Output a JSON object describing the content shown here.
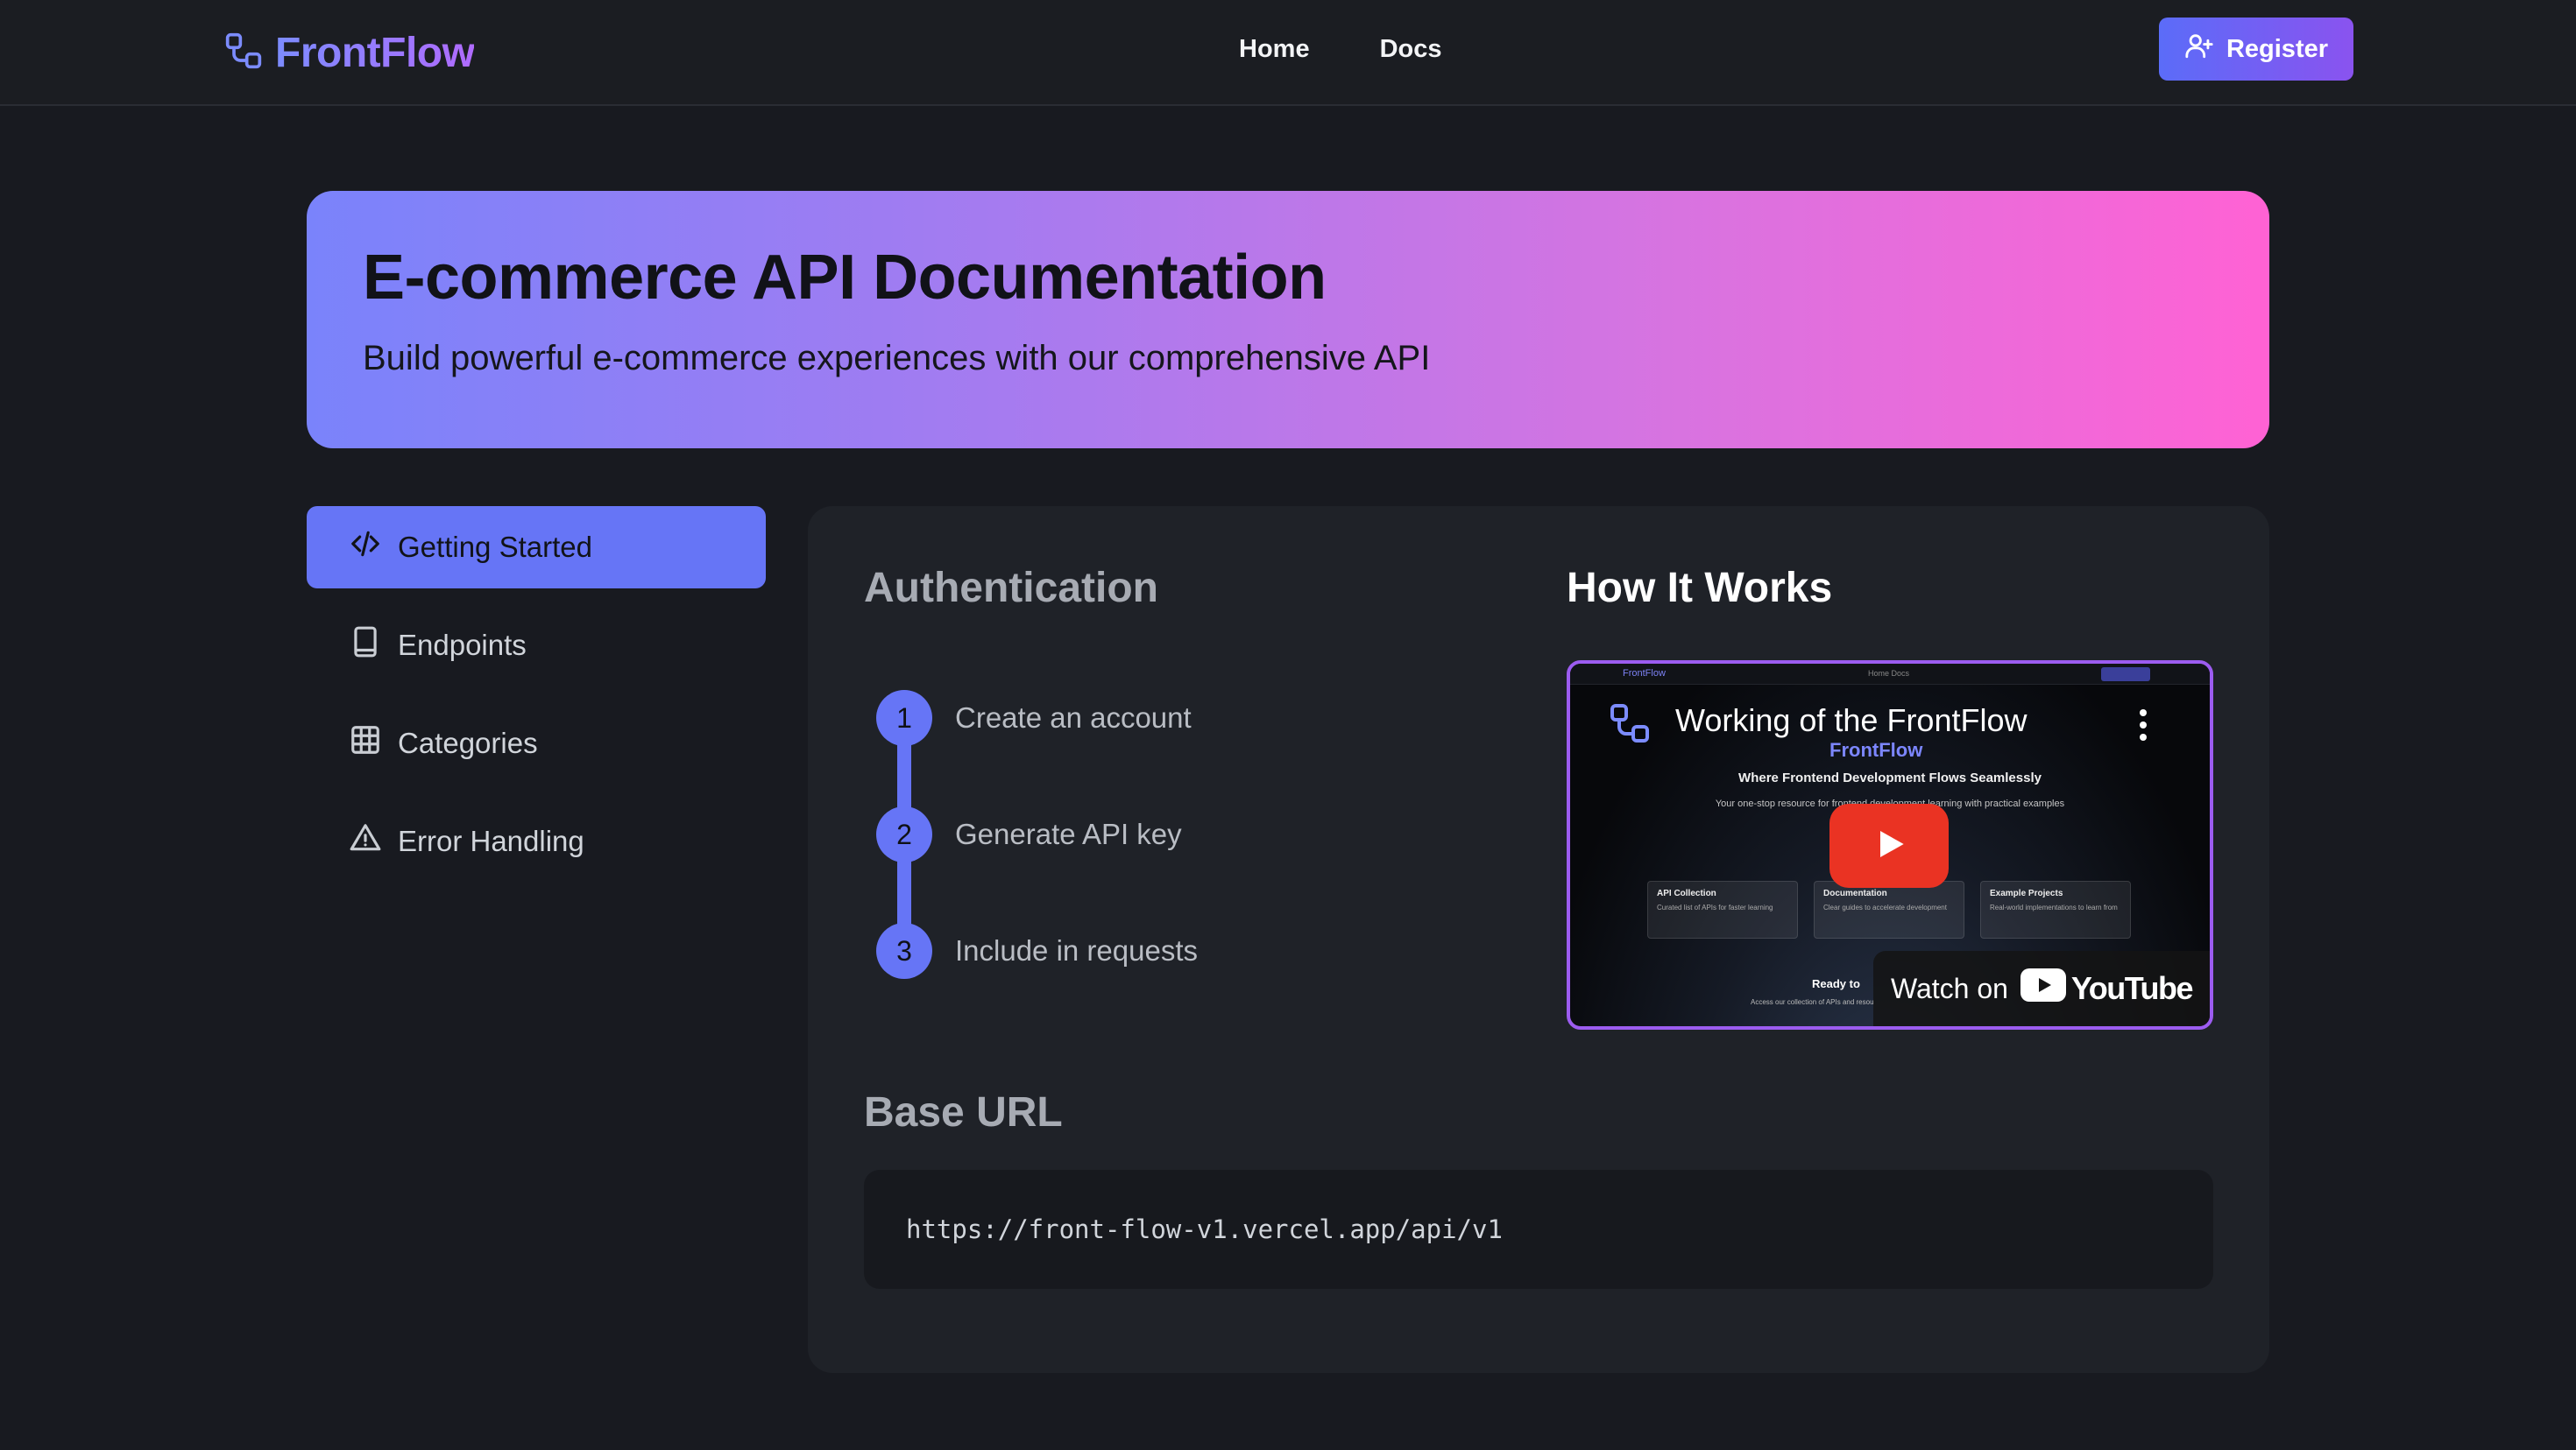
{
  "header": {
    "brand": "FrontFlow",
    "nav": [
      "Home",
      "Docs"
    ],
    "register_label": "Register"
  },
  "hero": {
    "title": "E-commerce API Documentation",
    "subtitle": "Build powerful e-commerce experiences with our comprehensive API"
  },
  "sidebar": {
    "items": [
      {
        "label": "Getting Started",
        "icon": "code-icon",
        "active": true
      },
      {
        "label": "Endpoints",
        "icon": "book-icon",
        "active": false
      },
      {
        "label": "Categories",
        "icon": "grid-icon",
        "active": false
      },
      {
        "label": "Error Handling",
        "icon": "warning-icon",
        "active": false
      }
    ]
  },
  "auth": {
    "title": "Authentication",
    "steps": [
      {
        "num": "1",
        "label": "Create an account"
      },
      {
        "num": "2",
        "label": "Generate API key"
      },
      {
        "num": "3",
        "label": "Include in requests"
      }
    ]
  },
  "how": {
    "title": "How It Works",
    "video": {
      "title": "Working of the FrontFlow",
      "brand": "FrontFlow",
      "tagline": "Where Frontend Development Flows Seamlessly",
      "subline": "Your one-stop resource for frontend development learning with practical examples",
      "nav_links": "Home    Docs",
      "cards": [
        {
          "title": "API Collection",
          "text": "Curated list of APIs for faster learning"
        },
        {
          "title": "Documentation",
          "text": "Clear guides to accelerate development"
        },
        {
          "title": "Example Projects",
          "text": "Real-world implementations to learn from"
        }
      ],
      "ready": "Ready to",
      "access": "Access our collection of APIs and resou",
      "watch_on": "Watch on",
      "youtube": "YouTube"
    }
  },
  "base_url": {
    "title": "Base URL",
    "value": "https://front-flow-v1.vercel.app/api/v1"
  },
  "colors": {
    "accent": "#6675f6",
    "background": "#181a20",
    "panel": "#1f2228",
    "video_border": "#9c5cf0",
    "play": "#ea3323"
  }
}
